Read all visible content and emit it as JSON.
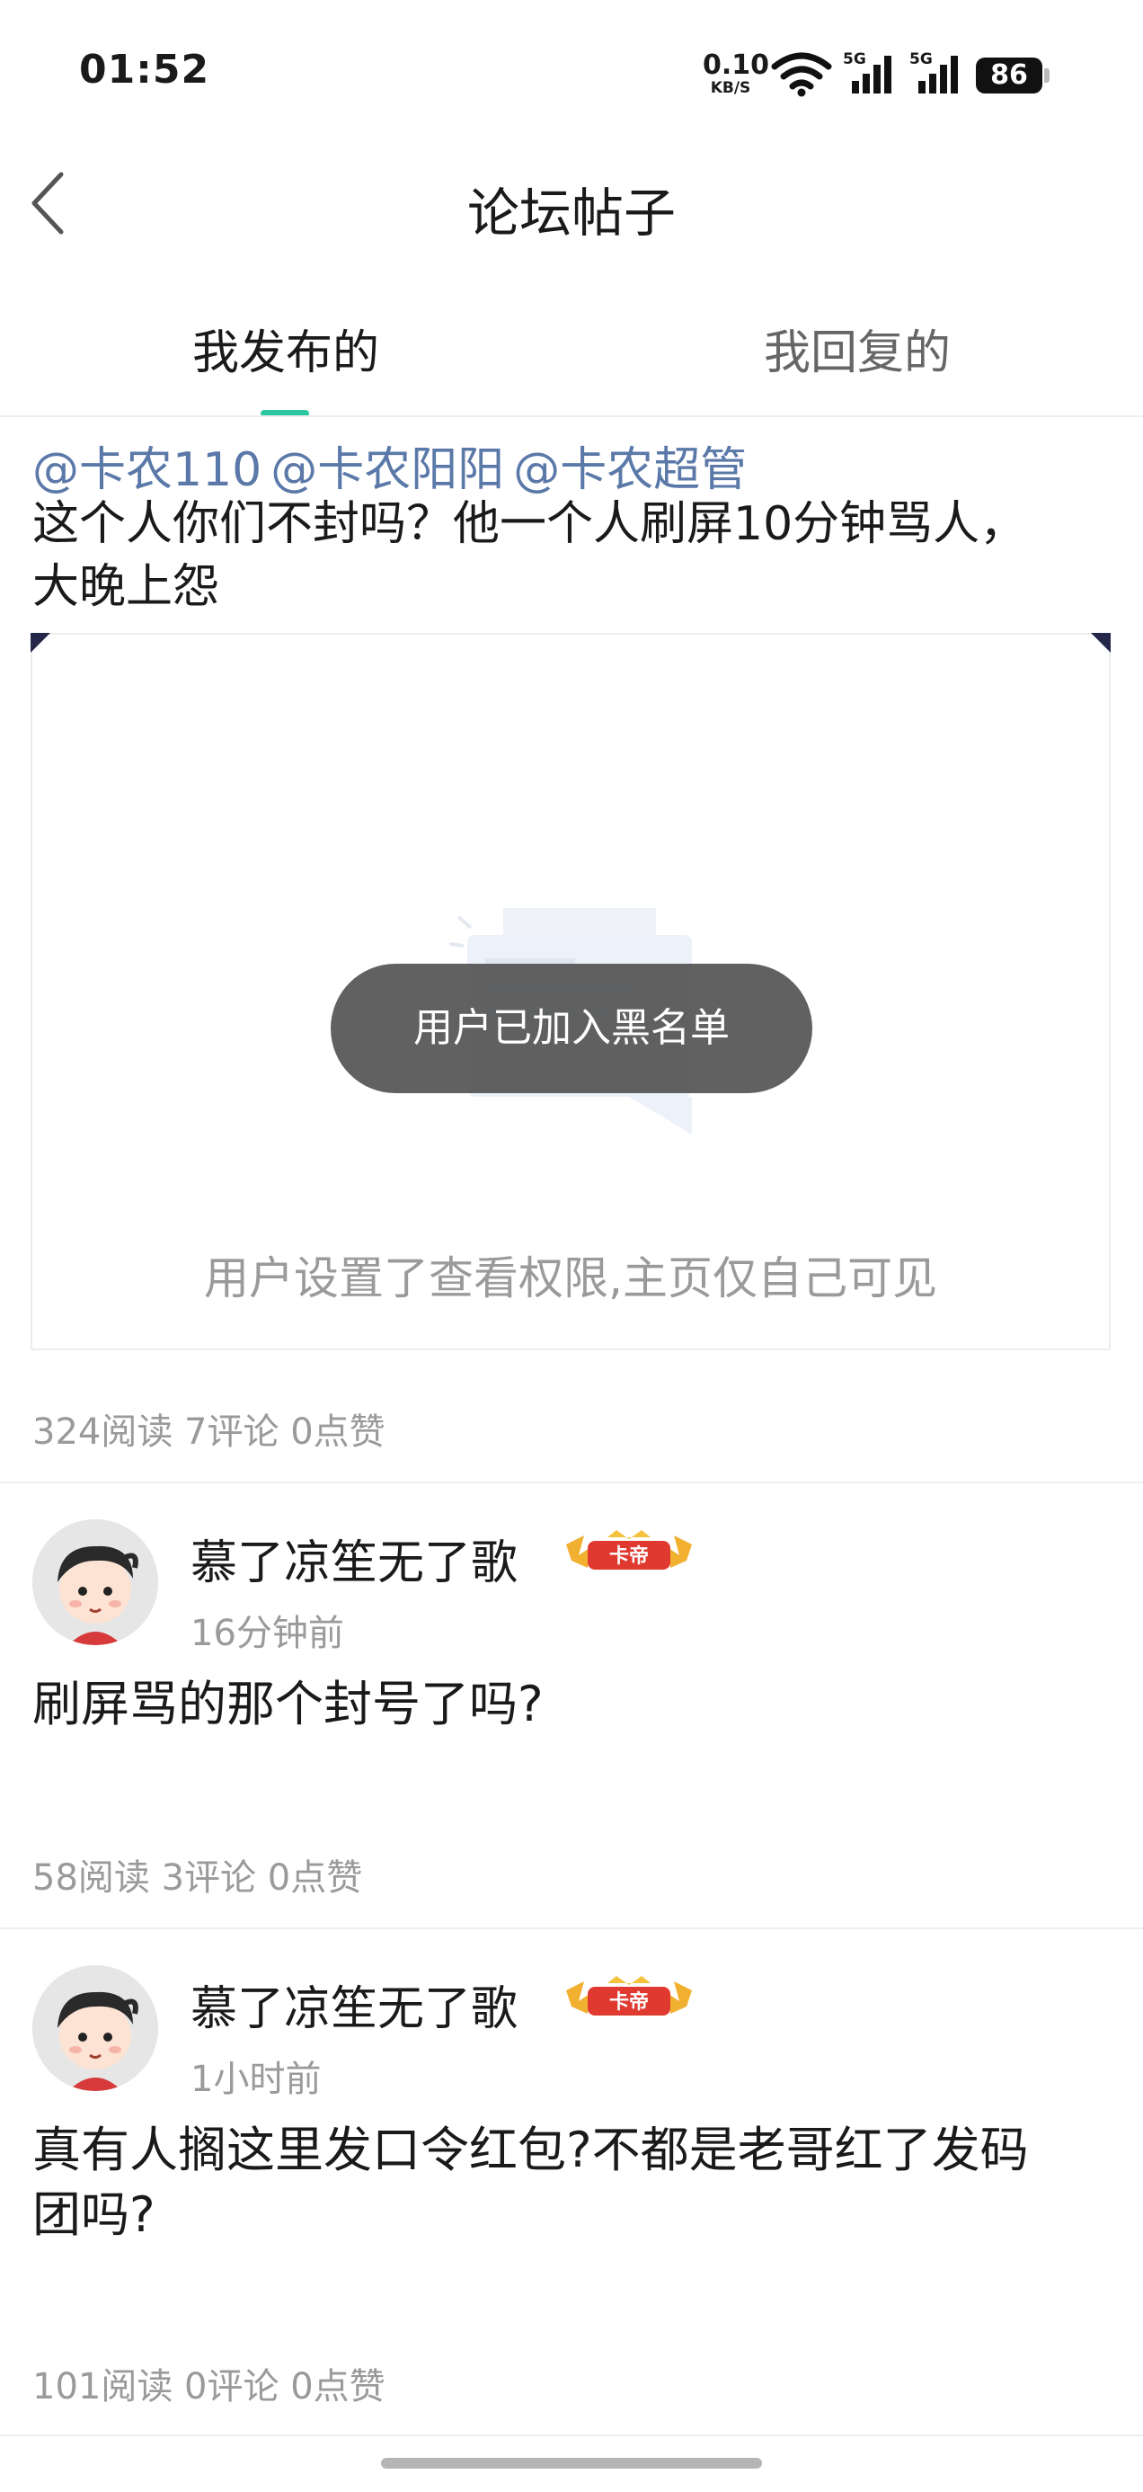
{
  "status_bar": {
    "time": "01:52",
    "net_speed_value": "0.10",
    "net_speed_unit": "KB/S",
    "signal_1_label": "5G",
    "signal_2_label": "5G",
    "battery": "86"
  },
  "header": {
    "title": "论坛帖子"
  },
  "tabs": [
    {
      "label": "我发布的",
      "active": true
    },
    {
      "label": "我回复的",
      "active": false
    }
  ],
  "colors": {
    "accent": "#2cc7a0",
    "mention": "#5a78a8",
    "muted": "#9a9a9a"
  },
  "post": {
    "mentions": [
      "@卡农110",
      "@卡农阳阳",
      "@卡农超管"
    ],
    "text_line1": "这个人你们不封吗？他一个人刷屏10分钟骂人，",
    "text_line2": "大晚上怨",
    "preview_notice": "用户设置了查看权限,主页仅自己可见",
    "stats": "324阅读 7评论 0点赞"
  },
  "toast": "用户已加入黑名单",
  "comments": [
    {
      "username": "慕了凉笙无了歌",
      "badge": "卡帝",
      "time": "16分钟前",
      "text_line1": "刷屏骂的那个封号了吗?",
      "text_line2": "",
      "stats": "58阅读 3评论 0点赞"
    },
    {
      "username": "慕了凉笙无了歌",
      "badge": "卡帝",
      "time": "1小时前",
      "text_line1": "真有人搁这里发口令红包?不都是老哥红了发码",
      "text_line2": "团吗?",
      "stats": "101阅读 0评论 0点赞"
    }
  ]
}
